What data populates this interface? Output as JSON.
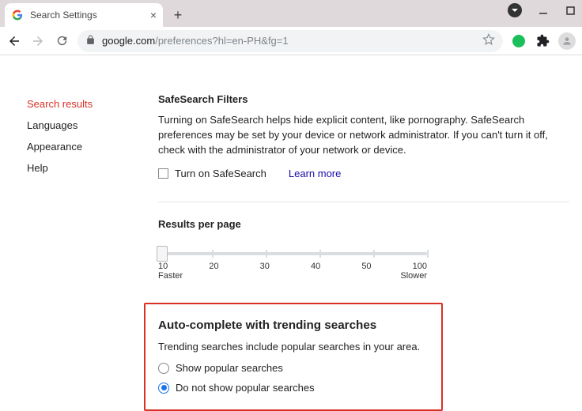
{
  "browser": {
    "tab_title": "Search Settings",
    "url_domain": "google.com",
    "url_path": "/preferences?hl=en-PH&fg=1"
  },
  "sidebar": {
    "items": [
      {
        "label": "Search results",
        "active": true
      },
      {
        "label": "Languages",
        "active": false
      },
      {
        "label": "Appearance",
        "active": false
      },
      {
        "label": "Help",
        "active": false
      }
    ]
  },
  "safesearch": {
    "heading": "SafeSearch Filters",
    "description": "Turning on SafeSearch helps hide explicit content, like pornography. SafeSearch preferences may be set by your device or network administrator. If you can't turn it off, check with the administrator of your network or device.",
    "checkbox_label": "Turn on SafeSearch",
    "learn_more": "Learn more"
  },
  "results_per_page": {
    "heading": "Results per page",
    "ticks": [
      "10",
      "20",
      "30",
      "40",
      "50",
      "100"
    ],
    "left_caption": "Faster",
    "right_caption": "Slower"
  },
  "autocomplete": {
    "heading": "Auto-complete with trending searches",
    "description": "Trending searches include popular searches in your area.",
    "option_show": "Show popular searches",
    "option_hide": "Do not show popular searches",
    "selected": "hide"
  }
}
